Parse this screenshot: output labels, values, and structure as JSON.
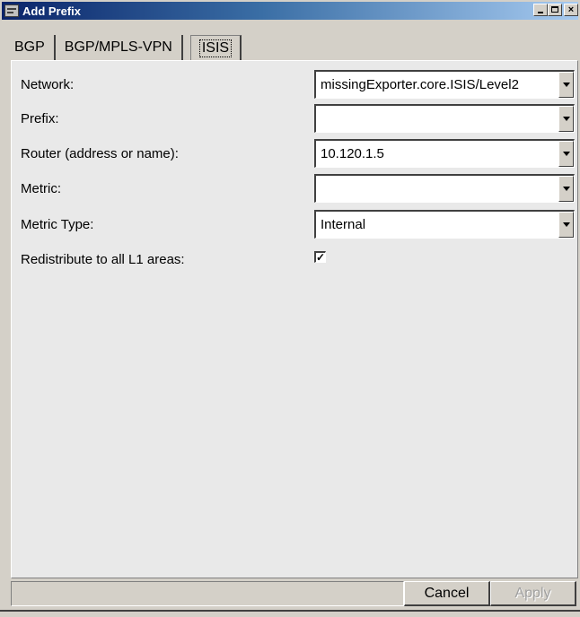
{
  "window": {
    "title": "Add Prefix"
  },
  "tabs": [
    {
      "label": "BGP"
    },
    {
      "label": "BGP/MPLS-VPN"
    },
    {
      "label": "ISIS",
      "active": true
    }
  ],
  "form": {
    "network": {
      "label": "Network:",
      "value": "missingExporter.core.ISIS/Level2"
    },
    "prefix": {
      "label": "Prefix:",
      "value": ""
    },
    "router": {
      "label": "Router (address or name):",
      "value": "10.120.1.5"
    },
    "metric": {
      "label": "Metric:",
      "value": ""
    },
    "metric_type": {
      "label": "Metric Type:",
      "value": "Internal"
    },
    "redistribute": {
      "label": "Redistribute to all L1 areas:",
      "checked": true,
      "mark": "✓"
    }
  },
  "buttons": {
    "cancel": "Cancel",
    "apply": "Apply"
  }
}
